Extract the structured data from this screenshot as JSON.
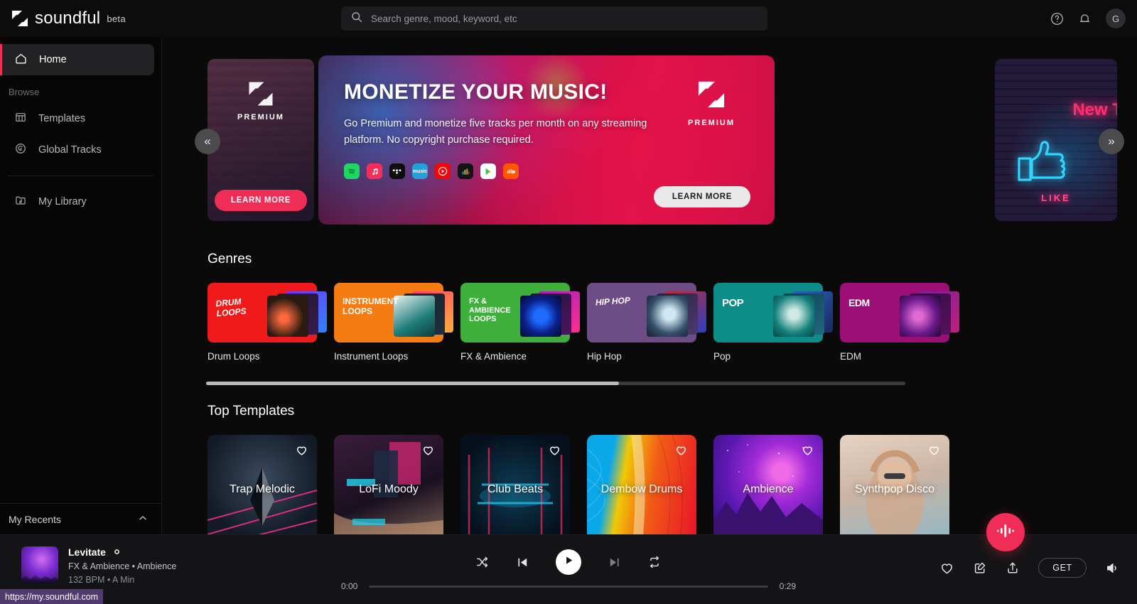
{
  "brand": {
    "name": "soundful",
    "beta": "beta",
    "logo_icon": "soundful-logo-icon"
  },
  "search": {
    "placeholder": "Search genre, mood, keyword, etc",
    "value": "",
    "icon": "search-icon"
  },
  "topbar": {
    "help_icon": "help-circle-icon",
    "notifications_icon": "bell-icon",
    "avatar_initial": "G"
  },
  "sidebar": {
    "home": {
      "label": "Home",
      "icon": "home-icon"
    },
    "browse_label": "Browse",
    "items": [
      {
        "label": "Templates",
        "icon": "grid-icon"
      },
      {
        "label": "Global Tracks",
        "icon": "disc-icon"
      }
    ],
    "library": {
      "label": "My Library",
      "icon": "folder-music-icon"
    },
    "recents": {
      "label": "My Recents",
      "icon": "chevron-up-icon"
    }
  },
  "carousel": {
    "prev_icon": "chevron-double-left-icon",
    "next_icon": "chevron-double-right-icon",
    "left_peek": {
      "logo_label": "PREMIUM",
      "button": "LEARN MORE"
    },
    "right_peek": {
      "neon_text": "New T",
      "like_text": "LIKE",
      "icon": "thumbs-up-neon-icon"
    },
    "hero": {
      "title": "MONETIZE YOUR MUSIC!",
      "subtitle": "Go Premium and monetize five tracks per month on any streaming platform. No copyright purchase required.",
      "logo_label": "PREMIUM",
      "button": "LEARN MORE",
      "services": [
        {
          "name": "spotify-icon",
          "color": "#1ED760"
        },
        {
          "name": "apple-music-icon",
          "color": "#FA2D5A"
        },
        {
          "name": "tidal-icon",
          "color": "#0E0E0E"
        },
        {
          "name": "amazon-music-icon",
          "color": "#25A0DA"
        },
        {
          "name": "youtube-music-icon",
          "color": "#FF0000"
        },
        {
          "name": "beatport-icon",
          "color": "#101010"
        },
        {
          "name": "google-play-icon",
          "color": "#FFFFFF"
        },
        {
          "name": "soundcloud-icon",
          "color": "#FF5500"
        }
      ]
    }
  },
  "genres": {
    "title": "Genres",
    "items": [
      {
        "name": "Drum Loops",
        "art_label": "DRUM LOOPS",
        "color": "#F01A1A"
      },
      {
        "name": "Instrument Loops",
        "art_label": "INSTRUMENT LOOPS",
        "color": "#F57C13"
      },
      {
        "name": "FX & Ambience",
        "art_label": "FX & AMBIENCE LOOPS",
        "color": "#3FAF3B"
      },
      {
        "name": "Hip Hop",
        "art_label": "hip hop",
        "color": "#6E4C86"
      },
      {
        "name": "Pop",
        "art_label": "POP",
        "color": "#0E8C88"
      },
      {
        "name": "EDM",
        "art_label": "EDM",
        "color": "#9C0F76"
      }
    ],
    "scroll_percent": 59
  },
  "templates": {
    "title": "Top Templates",
    "heart_icon": "heart-icon",
    "items": [
      {
        "name": "Trap Melodic",
        "liked": false
      },
      {
        "name": "LoFi Moody",
        "liked": false
      },
      {
        "name": "Club Beats",
        "liked": false
      },
      {
        "name": "Dembow Drums",
        "liked": false
      },
      {
        "name": "Ambience",
        "liked": false
      },
      {
        "name": "Synthpop Disco",
        "liked": false
      }
    ]
  },
  "player": {
    "track_title": "Levitate",
    "title_badge": "infinity-icon",
    "track_meta": "FX & Ambience • Ambience",
    "track_bpm": "132 BPM • A Min",
    "current_time": "0:00",
    "total_time": "0:29",
    "progress_percent": 0,
    "controls": {
      "shuffle_icon": "shuffle-icon",
      "prev_icon": "skip-previous-icon",
      "play_icon": "play-icon",
      "next_icon": "skip-next-icon",
      "repeat_icon": "repeat-icon"
    },
    "actions": {
      "like_icon": "heart-icon",
      "edit_icon": "edit-square-icon",
      "share_icon": "share-upload-icon",
      "get_label": "GET",
      "volume_icon": "volume-icon"
    }
  },
  "fab": {
    "icon": "waveform-icon",
    "color": "#ef2d56"
  },
  "statusbar": {
    "url": "https://my.soundful.com"
  }
}
